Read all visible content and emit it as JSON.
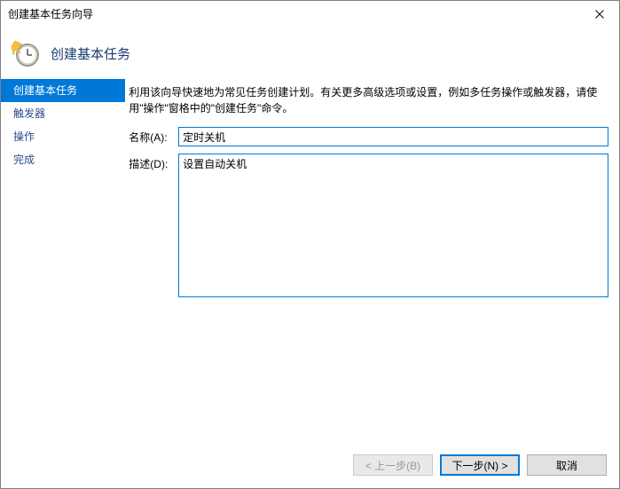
{
  "window": {
    "title": "创建基本任务向导"
  },
  "header": {
    "heading": "创建基本任务"
  },
  "sidebar": {
    "steps": [
      {
        "label": "创建基本任务",
        "active": true
      },
      {
        "label": "触发器",
        "active": false
      },
      {
        "label": "操作",
        "active": false
      },
      {
        "label": "完成",
        "active": false
      }
    ]
  },
  "content": {
    "instructions": "利用该向导快速地为常见任务创建计划。有关更多高级选项或设置，例如多任务操作或触发器，请使用\"操作\"窗格中的\"创建任务\"命令。",
    "name_label": "名称(A):",
    "name_value": "定时关机",
    "desc_label": "描述(D):",
    "desc_value": "设置自动关机"
  },
  "footer": {
    "back": "< 上一步(B)",
    "next": "下一步(N) >",
    "cancel": "取消"
  }
}
